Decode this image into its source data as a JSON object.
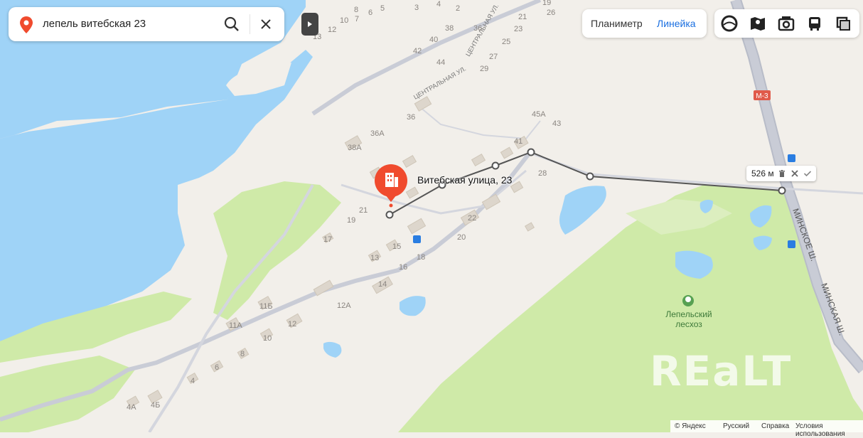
{
  "search": {
    "query": "лепель витебская 23"
  },
  "toolbar": {
    "planimeter_label": "Планиметр",
    "ruler_label": "Линейка"
  },
  "layers": [
    "panorama-icon",
    "map-transit-icon",
    "camera-icon",
    "bus-icon",
    "layers-icon"
  ],
  "poi": {
    "name": "Витебская улица, 23"
  },
  "ruler": {
    "distance": "526 м"
  },
  "forest": {
    "name_line1": "Лепельский",
    "name_line2": "лесхоз"
  },
  "roads": {
    "highway_badge": "М-3",
    "highway_name": "МИНСКОЕ Ш.",
    "highway_name2": "МИНСКАЯ Ш.",
    "street1": "ЦЕНТРАЛЬНАЯ УЛ.",
    "street2": "ЦЕНТРАЛЬНАЯ УЛ."
  },
  "house_numbers": [
    "8",
    "5",
    "3",
    "4",
    "2",
    "19",
    "26",
    "6",
    "21",
    "12",
    "10",
    "7",
    "13",
    "38",
    "36",
    "23",
    "40",
    "25",
    "42",
    "27",
    "44",
    "29",
    "36",
    "45А",
    "43",
    "36А",
    "41",
    "38А",
    "28",
    "21",
    "19",
    "22",
    "17",
    "20",
    "15",
    "13",
    "18",
    "16",
    "14",
    "11Б",
    "12А",
    "11А",
    "12",
    "10",
    "8",
    "6",
    "4",
    "4А",
    "4Б"
  ],
  "watermark": "REaLT",
  "footer": {
    "copyright": "© Яндекс",
    "language": "Русский",
    "help": "Справка",
    "terms": "Условия использования"
  },
  "colors": {
    "water": "#9fd3f7",
    "forest": "#cfeaa8",
    "road": "#c9ccd6",
    "marker": "#f04b2e",
    "accent": "#1a6fe0"
  }
}
